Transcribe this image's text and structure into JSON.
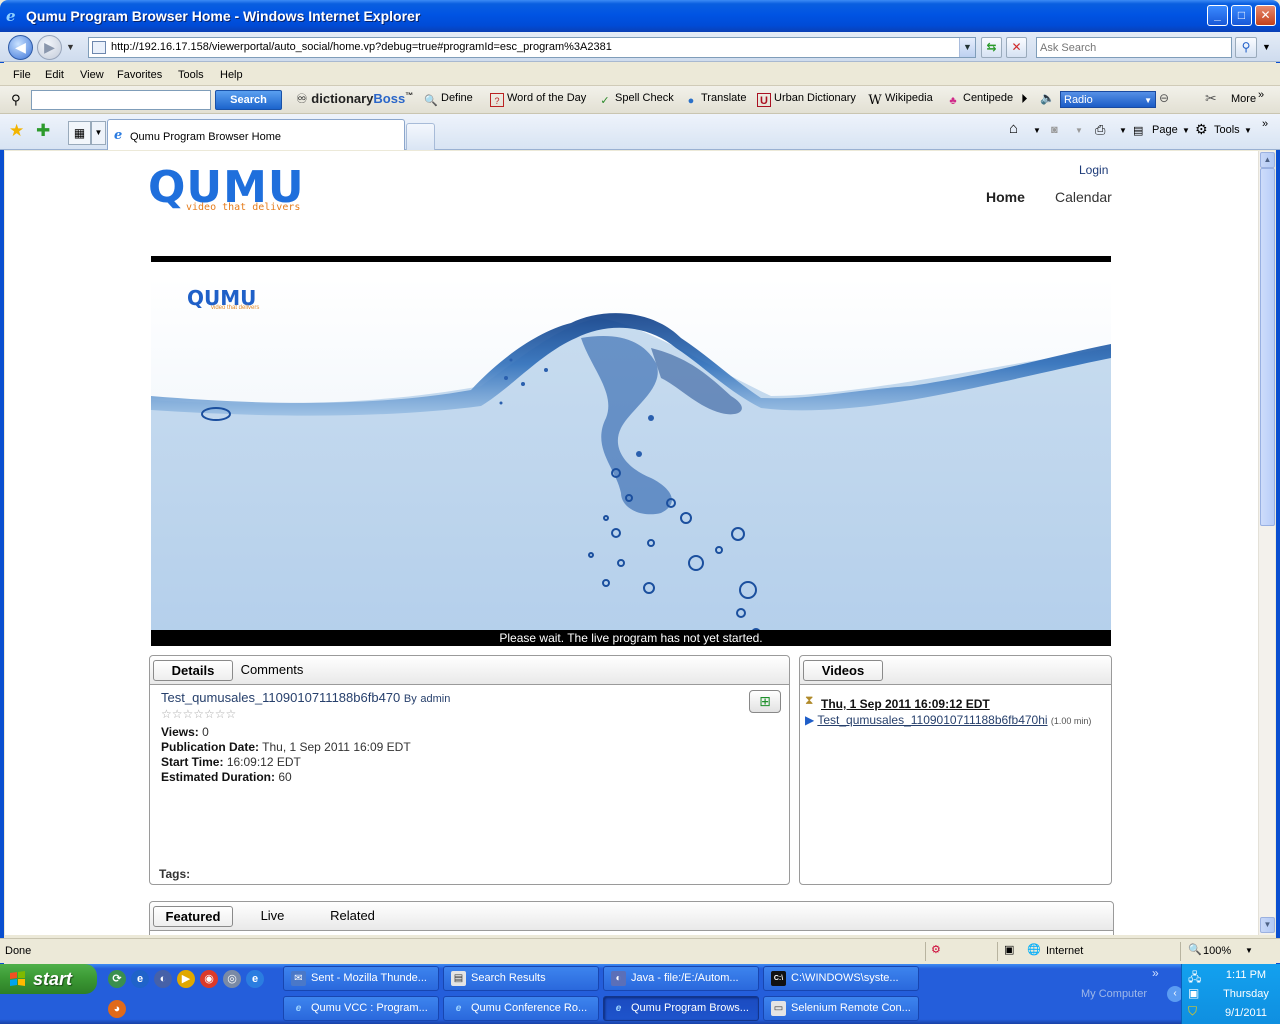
{
  "window": {
    "title": "Qumu Program Browser Home - Windows Internet Explorer",
    "controls": {
      "minimize": "_",
      "maximize": "□",
      "close": "✕"
    }
  },
  "address_bar": {
    "url": "http://192.16.17.158/viewerportal/auto_social/home.vp?debug=true#programId=esc_program%3A2381",
    "search_placeholder": "Ask Search"
  },
  "menu": [
    "File",
    "Edit",
    "View",
    "Favorites",
    "Tools",
    "Help"
  ],
  "dict_toolbar": {
    "search_button": "Search",
    "logo_prefix": "dictionary",
    "logo_brand": "Boss",
    "logo_tm": "™",
    "items": [
      "Define",
      "Word of the Day",
      "Spell Check",
      "Translate",
      "Urban Dictionary",
      "Wikipedia",
      "Centipede"
    ],
    "radio_label": "Radio",
    "more_label": "More"
  },
  "tabs": {
    "active_label": "Qumu Program Browser Home",
    "commands": {
      "page": "Page",
      "tools": "Tools"
    }
  },
  "page": {
    "logo_word": "QUMU",
    "logo_tagline": "video that delivers",
    "login_label": "Login",
    "nav": {
      "home": "Home",
      "calendar": "Calendar"
    },
    "hero_logo_word": "QUMU",
    "hero_logo_tagline": "video that delivers",
    "status_message": "Please wait. The live program has not yet started.",
    "details_panel": {
      "tab_details": "Details",
      "tab_comments": "Comments",
      "program_title": "Test_qumusales_1109010711188b6fb470",
      "by_label": "By",
      "by_user": "admin",
      "stars": "☆☆☆☆☆☆☆",
      "views_label": "Views:",
      "views_value": "0",
      "pub_label": "Publication Date:",
      "pub_value": "Thu, 1 Sep 2011 16:09 EDT",
      "start_label": "Start Time:",
      "start_value": "16:09:12 EDT",
      "dur_label": "Estimated Duration:",
      "dur_value": "60",
      "tags_label": "Tags:"
    },
    "videos_panel": {
      "tab_label": "Videos",
      "date_link": "Thu, 1 Sep 2011 16:09:12 EDT",
      "video_link": "Test_qumusales_1109010711188b6fb470hi",
      "duration": "(1.00 min)"
    },
    "bottom_tabs": [
      "Featured",
      "Live",
      "Related"
    ]
  },
  "status_bar": {
    "left_text": "Done",
    "zone": "Internet",
    "zoom": "100%"
  },
  "taskbar": {
    "start_label": "start",
    "buttons_row1": [
      "Sent - Mozilla Thunde...",
      "Search Results",
      "Java - file:/E:/Autom...",
      "C:\\WINDOWS\\syste..."
    ],
    "buttons_row2": [
      "Qumu VCC : Program...",
      "Qumu Conference Ro...",
      "Qumu Program Brows...",
      "Selenium Remote Con..."
    ],
    "my_computer": "My Computer",
    "clock_time": "1:11 PM",
    "clock_day": "Thursday",
    "clock_date": "9/1/2011"
  },
  "colors": {
    "xp_blue": "#0054e3",
    "qumu_blue": "#1f6fdc",
    "qumu_orange": "#e57c1c",
    "start_green": "#3c9a35"
  }
}
